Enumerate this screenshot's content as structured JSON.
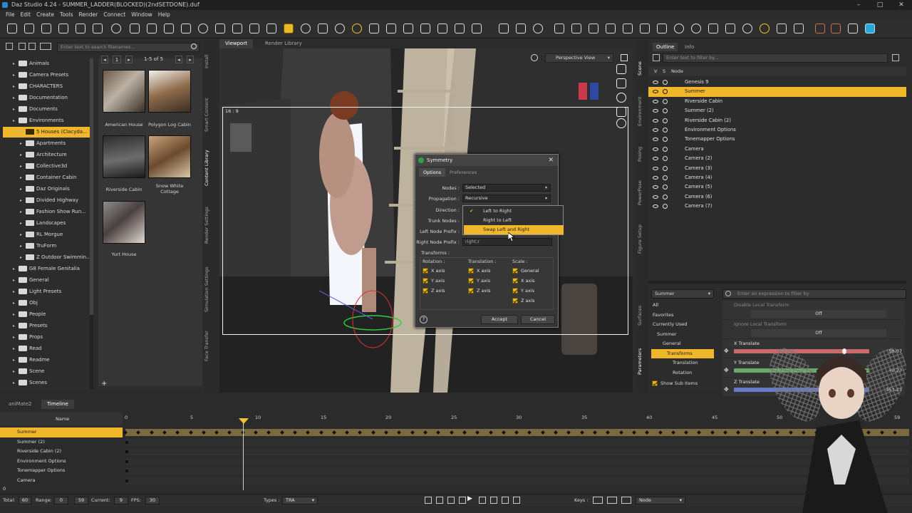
{
  "window": {
    "title": "Daz Studio 4.24 - SUMMER_LADDER(BLOCKED)(2ndSETDONE).duf",
    "controls": [
      "–",
      "□",
      "✕"
    ]
  },
  "menu": [
    "File",
    "Edit",
    "Create",
    "Tools",
    "Render",
    "Connect",
    "Window",
    "Help"
  ],
  "content_library": {
    "search_placeholder": "Enter text to search filenames...",
    "page": "1",
    "range": "1-5 of 5",
    "folders": [
      {
        "label": "Animals",
        "depth": 0
      },
      {
        "label": "Camera Presets",
        "depth": 0
      },
      {
        "label": "CHARACTERS",
        "depth": 0
      },
      {
        "label": "Documentation",
        "depth": 0
      },
      {
        "label": "Documents",
        "depth": 0
      },
      {
        "label": "Environments",
        "depth": 0
      },
      {
        "label": "5 Houses (Clacyda...",
        "depth": 1,
        "selected": true
      },
      {
        "label": "Apartments",
        "depth": 1
      },
      {
        "label": "Architecture",
        "depth": 1
      },
      {
        "label": "Collective3d",
        "depth": 1
      },
      {
        "label": "Container Cabin",
        "depth": 1
      },
      {
        "label": "Daz Originals",
        "depth": 1
      },
      {
        "label": "Divided Highway",
        "depth": 1
      },
      {
        "label": "Fashion Show Run...",
        "depth": 1
      },
      {
        "label": "Landscapes",
        "depth": 1
      },
      {
        "label": "RL Morgue",
        "depth": 1
      },
      {
        "label": "TruForm",
        "depth": 1
      },
      {
        "label": "Z Outdoor Swimmin...",
        "depth": 1
      },
      {
        "label": "G8 Female Genitalia",
        "depth": 0
      },
      {
        "label": "General",
        "depth": 0
      },
      {
        "label": "Light Presets",
        "depth": 0
      },
      {
        "label": "Obj",
        "depth": 0
      },
      {
        "label": "People",
        "depth": 0
      },
      {
        "label": "Presets",
        "depth": 0
      },
      {
        "label": "Props",
        "depth": 0
      },
      {
        "label": "Read",
        "depth": 0
      },
      {
        "label": "Readme",
        "depth": 0
      },
      {
        "label": "Scene",
        "depth": 0
      },
      {
        "label": "Scenes",
        "depth": 0
      }
    ],
    "thumbnails": [
      "American House",
      "Polygon Log Cabin",
      "Riverside Cabin",
      "Snow White Cottage",
      "Yurt House"
    ]
  },
  "left_side_tabs": [
    "Install",
    "Smart Content",
    "Content Library",
    "Render Settings",
    "Simulation Settings",
    "Face Transfer"
  ],
  "viewport": {
    "tabs": [
      "Viewport",
      "Render Library"
    ],
    "camera": "Perspective View",
    "aspect": "16 : 9"
  },
  "symmetry_dialog": {
    "title": "Symmetry",
    "tabs": [
      "Options",
      "Preferences"
    ],
    "nodes_label": "Nodes :",
    "nodes_value": "Selected",
    "propagation_label": "Propagation :",
    "propagation_value": "Recursive",
    "direction_label": "Direction :",
    "trunk_label": "Trunk Nodes :",
    "left_prefix_label": "Left Node Prefix :",
    "right_prefix_label": "Right Node Prefix :",
    "right_prefix_value": "right;r",
    "direction_options": [
      "Left to Right",
      "Right to Left",
      "Swap Left and Right"
    ],
    "direction_checked": "Left to Right",
    "direction_hover": "Swap Left and Right",
    "transforms_label": "Transforms :",
    "rotation_label": "Rotation :",
    "translation_label": "Translation :",
    "scale_label": "Scale :",
    "rotation": [
      "X axis",
      "Y axis",
      "Z axis"
    ],
    "translation": [
      "X axis",
      "Y axis",
      "Z axis"
    ],
    "scale": [
      "General",
      "X axis",
      "Y axis",
      "Z axis"
    ],
    "help": "?",
    "accept": "Accept",
    "cancel": "Cancel"
  },
  "scene": {
    "tabs": [
      "Outline",
      "Info"
    ],
    "filter_placeholder": "Enter text to filter by...",
    "col_v": "V",
    "col_s": "S",
    "col_node": "Node",
    "nodes": [
      {
        "label": "Genesis 9"
      },
      {
        "label": "Summer",
        "selected": true
      },
      {
        "label": "Riverside Cabin"
      },
      {
        "label": "Summer (2)"
      },
      {
        "label": "Riverside Cabin (2)"
      },
      {
        "label": "Environment Options"
      },
      {
        "label": "Tonemapper Options"
      },
      {
        "label": "Camera"
      },
      {
        "label": "Camera (2)"
      },
      {
        "label": "Camera (3)"
      },
      {
        "label": "Camera (4)"
      },
      {
        "label": "Camera (5)"
      },
      {
        "label": "Camera (6)"
      },
      {
        "label": "Camera (7)"
      }
    ]
  },
  "right_side_tabs": [
    "Scene",
    "Environment",
    "Posing",
    "PowerPose",
    "Figure Setup"
  ],
  "right_lower_tabs": [
    "Surfaces",
    "Parameters"
  ],
  "parameters": {
    "node_select": "Summer",
    "filter_placeholder": "Enter an expression to filter by",
    "groups": [
      {
        "label": "All"
      },
      {
        "label": "Favorites"
      },
      {
        "label": "Currently Used"
      },
      {
        "label": "Summer"
      },
      {
        "label": "General"
      },
      {
        "label": "Transforms",
        "selected": true
      },
      {
        "label": "Translation"
      },
      {
        "label": "Rotation"
      }
    ],
    "show_sub_items": "Show Sub Items",
    "rows": [
      {
        "label": "Disable Local Transform",
        "value": "Off"
      },
      {
        "label": "Ignore Local Transform",
        "value": "Off"
      },
      {
        "label": "X Translate",
        "value": "58.07",
        "color": "#c76a6a",
        "level": 0.8
      },
      {
        "label": "Y Translate",
        "value": "40.27",
        "color": "#6aa86a",
        "level": 0.78
      },
      {
        "label": "Z Translate",
        "value": "553.23",
        "color": "#6a7ac7",
        "level": 0.9
      }
    ]
  },
  "timeline": {
    "tabs": [
      "aniMate2",
      "Timeline"
    ],
    "name_header": "Name",
    "frame_ticks": [
      "0",
      "5",
      "10",
      "15",
      "20",
      "25",
      "30",
      "35",
      "40",
      "45",
      "50",
      "59"
    ],
    "rows": [
      {
        "label": "Summer",
        "selected": true
      },
      {
        "label": "Summer (2)"
      },
      {
        "label": "Riverside Cabin (2)"
      },
      {
        "label": "Environment Options"
      },
      {
        "label": "Tonemapper Options"
      },
      {
        "label": "Camera"
      }
    ],
    "bottom": {
      "total_label": "Total:",
      "total": "60",
      "range_label": "Range:",
      "range_start": "0",
      "range_end": "59",
      "current_label": "Current:",
      "current": "9",
      "fps_label": "FPS:",
      "fps": "30",
      "types_label": "Types :",
      "types": "TRA",
      "keys_label": "Keys :",
      "node_mode": "Node",
      "zero": "0"
    }
  },
  "colors": {
    "accent": "#f0b72b",
    "panel": "#2c2c2c",
    "viewport": "#2f2f2f"
  }
}
